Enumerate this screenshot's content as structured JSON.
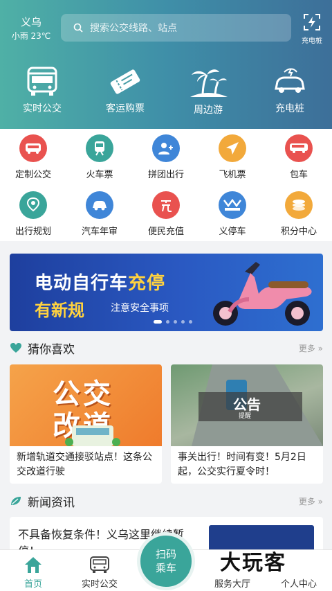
{
  "header": {
    "city": "义乌",
    "weather": "小雨 23℃",
    "search_placeholder": "搜索公交线路、站点",
    "charge_label": "充电桩",
    "menu": [
      {
        "label": "实时公交",
        "icon": "bus-icon"
      },
      {
        "label": "客运购票",
        "icon": "ticket-icon"
      },
      {
        "label": "周边游",
        "icon": "palm-tree-icon"
      },
      {
        "label": "充电桩",
        "icon": "electric-car-icon"
      }
    ]
  },
  "services": [
    {
      "label": "定制公交",
      "icon": "custom-bus-icon",
      "color": "#e9524f"
    },
    {
      "label": "火车票",
      "icon": "train-icon",
      "color": "#3aa59a"
    },
    {
      "label": "拼团出行",
      "icon": "group-add-icon",
      "color": "#3f86d8"
    },
    {
      "label": "飞机票",
      "icon": "plane-icon",
      "color": "#f2a93b"
    },
    {
      "label": "包车",
      "icon": "charter-bus-icon",
      "color": "#e9524f"
    },
    {
      "label": "出行规划",
      "icon": "route-plan-icon",
      "color": "#3aa59a"
    },
    {
      "label": "汽车年审",
      "icon": "car-inspection-icon",
      "color": "#3f86d8"
    },
    {
      "label": "便民充值",
      "icon": "recharge-icon",
      "color": "#e9524f"
    },
    {
      "label": "义停车",
      "icon": "parking-logo-icon",
      "color": "#3f86d8"
    },
    {
      "label": "积分中心",
      "icon": "coins-icon",
      "color": "#f2a93b"
    }
  ],
  "banner": {
    "line1a": "电动自行车",
    "line1b": "充停",
    "line2": "有新规",
    "line3": "注意安全事项"
  },
  "recommend": {
    "title": "猜你喜欢",
    "more": "更多 »",
    "cards": [
      {
        "img_text_1": "公交",
        "img_text_2": "改道",
        "text": "新增轨道交通接驳站点！这条公交改道行驶"
      },
      {
        "img_text_1": "公告",
        "img_text_2": "提醒",
        "text": "事关出行！时间有变！5月2日起，公交实行夏令时！"
      }
    ]
  },
  "news": {
    "title": "新闻资讯",
    "more": "更多 »",
    "item_text": "不具备恢复条件！义乌这里继续暂停！"
  },
  "tabbar": {
    "tabs": [
      {
        "label": "首页",
        "icon": "home-icon"
      },
      {
        "label": "实时公交",
        "icon": "bus-icon"
      },
      {
        "label": "服务大厅",
        "icon": "service-icon"
      },
      {
        "label": "个人中心",
        "icon": "user-icon"
      }
    ],
    "scan_line1": "扫码",
    "scan_line2": "乘车"
  },
  "watermark": "大玩客",
  "colors": {
    "accent": "#3aa59a",
    "header_start": "#4fb0a6",
    "header_end": "#3d6f99"
  }
}
